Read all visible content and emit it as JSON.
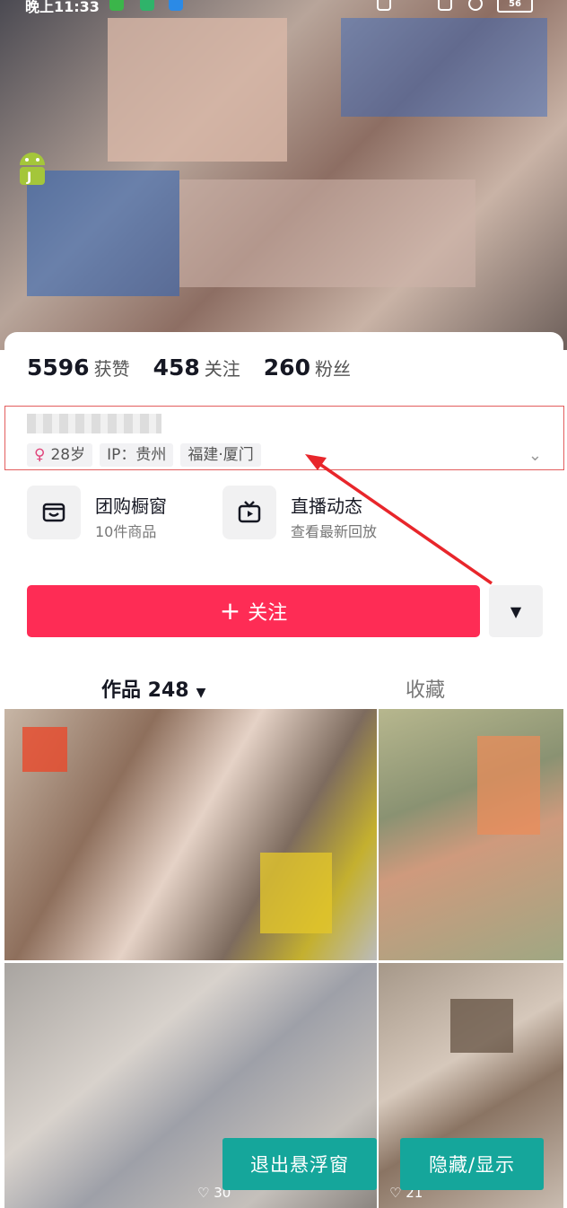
{
  "status_bar": {
    "time": "晚上11:33",
    "battery": "56"
  },
  "stats": [
    {
      "number": "5596",
      "label": "获赞"
    },
    {
      "number": "458",
      "label": "关注"
    },
    {
      "number": "260",
      "label": "粉丝"
    }
  ],
  "tags": [
    {
      "icon": "female-icon",
      "text": "28岁"
    },
    {
      "text": "IP：贵州"
    },
    {
      "text": "福建·厦门"
    }
  ],
  "features": [
    {
      "title": "团购橱窗",
      "subtitle": "10件商品",
      "icon": "shop-window-icon"
    },
    {
      "title": "直播动态",
      "subtitle": "查看最新回放",
      "icon": "live-tv-icon"
    }
  ],
  "follow_button": {
    "label": "关注"
  },
  "tabs": {
    "works_label": "作品 248",
    "favorites_label": "收藏"
  },
  "videos": [
    {
      "likes": ""
    },
    {
      "likes": ""
    },
    {
      "likes": "30"
    },
    {
      "likes": "21"
    }
  ],
  "floating": {
    "exit_label": "退出悬浮窗",
    "toggle_label": "隐藏/显示"
  },
  "colors": {
    "accent": "#fe2c55",
    "float_button": "#15a69b",
    "annotation_arrow": "#e8262b"
  }
}
